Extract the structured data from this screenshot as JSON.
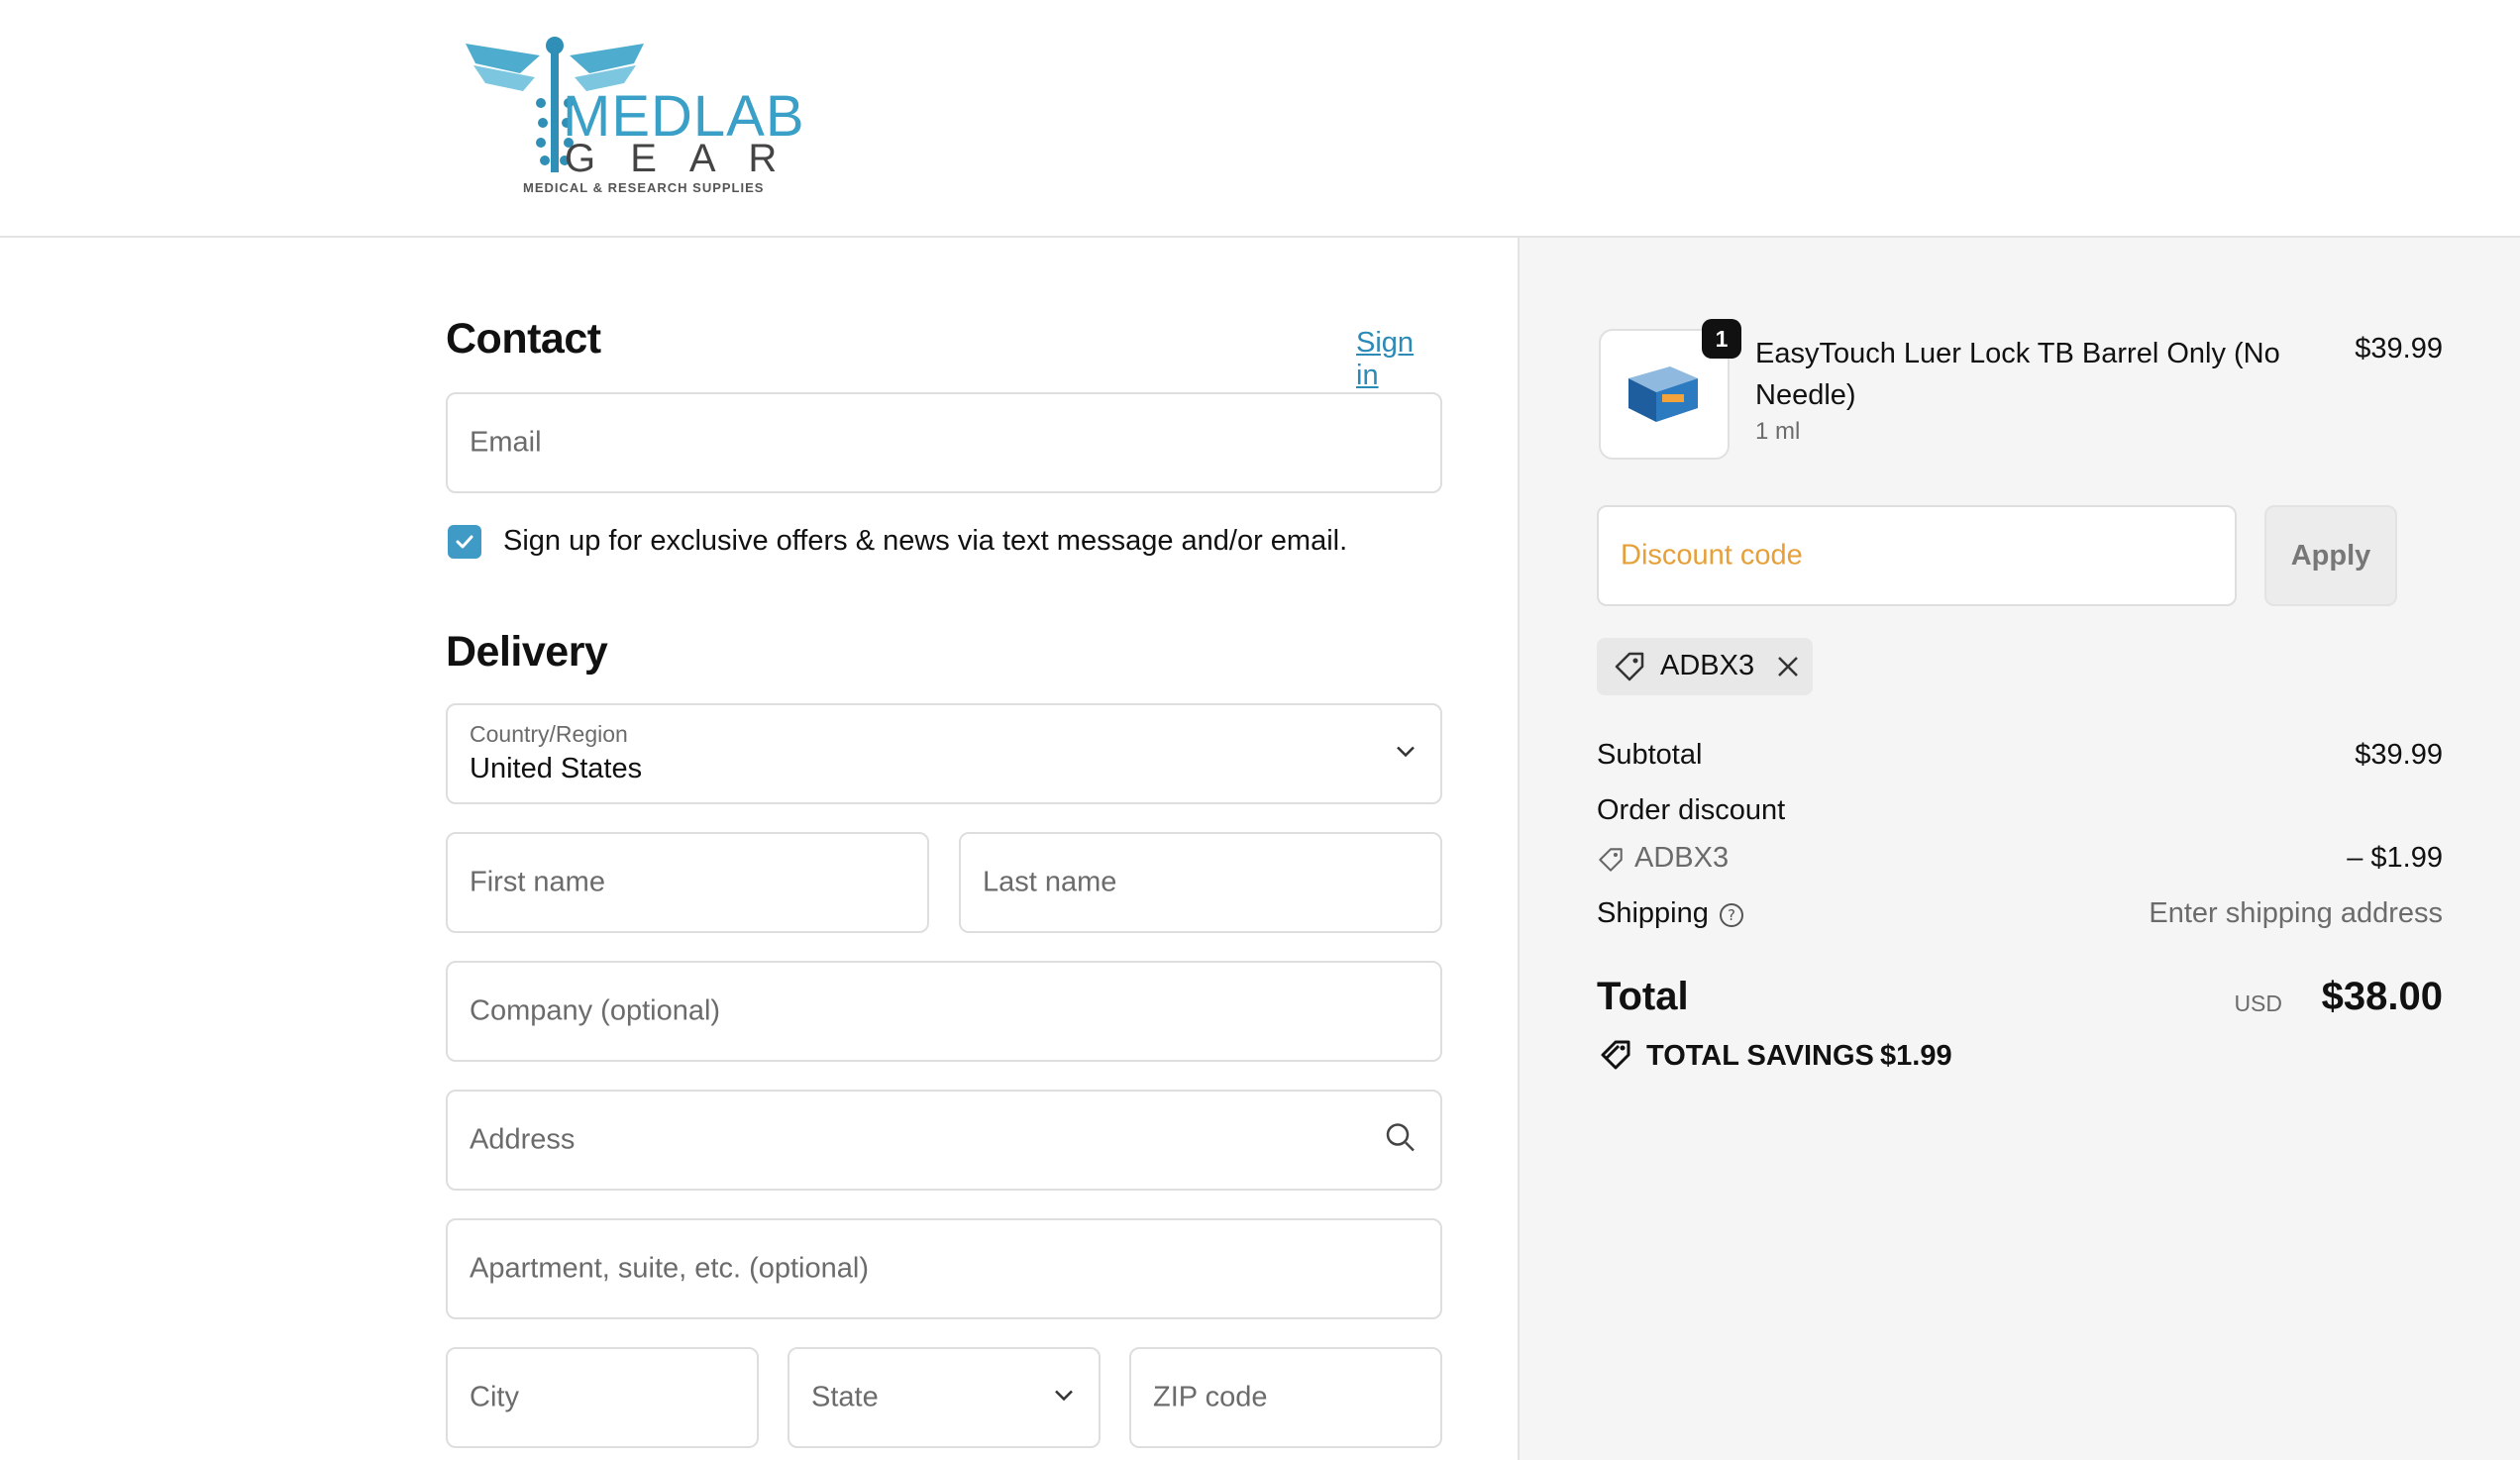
{
  "brand": {
    "logo_line1": "MEDLAB",
    "logo_line2": "G E A R",
    "logo_tagline": "MEDICAL & RESEARCH SUPPLIES"
  },
  "contact": {
    "heading": "Contact",
    "sign_in": "Sign in",
    "email_placeholder": "Email",
    "sms_opt_in": "Sign up for exclusive offers & news via text message and/or email."
  },
  "delivery": {
    "heading": "Delivery",
    "country_label": "Country/Region",
    "country_value": "United States",
    "first_name": "First name",
    "last_name": "Last name",
    "company": "Company (optional)",
    "address": "Address",
    "apartment": "Apartment, suite, etc. (optional)",
    "city": "City",
    "state": "State",
    "zip": "ZIP code"
  },
  "cart": {
    "item": {
      "qty_badge": "1",
      "name": "EasyTouch Luer Lock TB Barrel Only (No Needle)",
      "variant": "1 ml",
      "price": "$39.99"
    },
    "discount_placeholder": "Discount code",
    "apply_label": "Apply",
    "applied_code": "ADBX3",
    "subtotal_label": "Subtotal",
    "subtotal_value": "$39.99",
    "order_discount_label": "Order discount",
    "discount_code": "ADBX3",
    "discount_value": "– $1.99",
    "shipping_label": "Shipping",
    "shipping_value": "Enter shipping address",
    "total_label": "Total",
    "currency": "USD",
    "total_value": "$38.00",
    "savings_label": "TOTAL SAVINGS",
    "savings_value": "$1.99"
  },
  "colors": {
    "accent": "#3f9ac6",
    "link": "#2c8ab7",
    "discount_placeholder": "#e6a03a"
  }
}
